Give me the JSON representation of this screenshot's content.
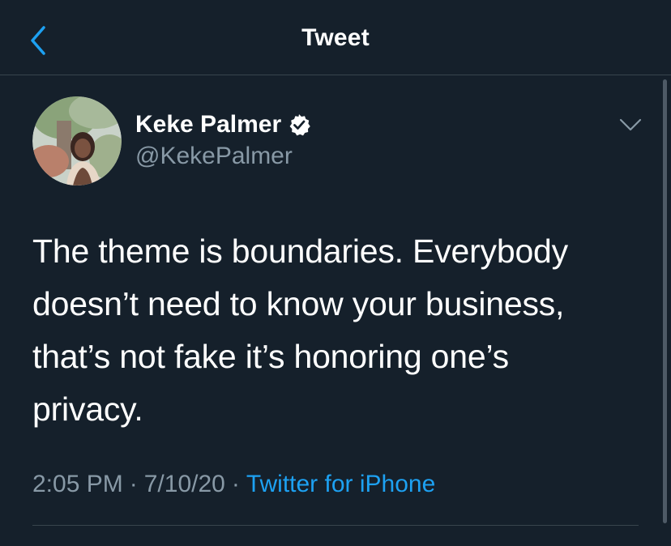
{
  "header": {
    "title": "Tweet",
    "back_icon": "chevron-left-icon"
  },
  "tweet": {
    "author": {
      "display_name": "Keke Palmer",
      "handle": "@KekePalmer",
      "verified_icon": "verified-badge-icon"
    },
    "text_lines": [
      "The theme is boundaries. Everybody",
      "doesn’t need to know your business,",
      "that’s not fake it’s honoring one’s",
      "privacy."
    ],
    "time": "2:05 PM",
    "date": "7/10/20",
    "separator": "·",
    "source": "Twitter for iPhone",
    "menu_icon": "chevron-down-icon"
  },
  "colors": {
    "background": "#15202b",
    "secondary_text": "#8899a6",
    "link": "#1da1f2",
    "divider": "#38444d"
  }
}
